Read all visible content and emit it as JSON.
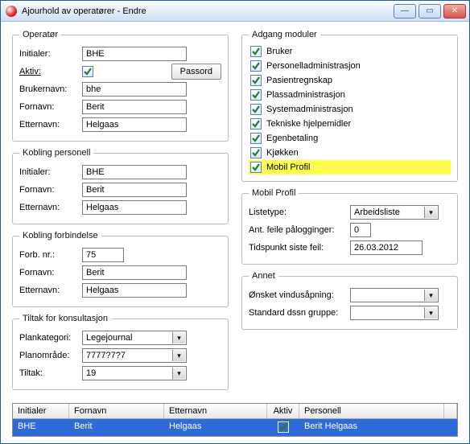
{
  "window": {
    "title": "Ajourhold av operatører - Endre"
  },
  "operator": {
    "legend": "Operatør",
    "initials_label": "Initialer:",
    "initials": "BHE",
    "active_label": "Aktiv:",
    "passord_btn": "Passord",
    "username_label": "Brukernavn:",
    "username": "bhe",
    "firstname_label": "Fornavn:",
    "firstname": "Berit",
    "lastname_label": "Etternavn:",
    "lastname": "Helgaas"
  },
  "kpersonell": {
    "legend": "Kobling personell",
    "initials_label": "Initialer:",
    "initials": "BHE",
    "firstname_label": "Fornavn:",
    "firstname": "Berit",
    "lastname_label": "Etternavn:",
    "lastname": "Helgaas"
  },
  "kforbindelse": {
    "legend": "Kobling forbindelse",
    "forbnr_label": "Forb. nr.:",
    "forbnr": "75",
    "firstname_label": "Fornavn:",
    "firstname": "Berit",
    "lastname_label": "Etternavn:",
    "lastname": "Helgaas"
  },
  "tiltak": {
    "legend": "Tiltak for konsultasjon",
    "plankat_label": "Plankategori:",
    "plankat": "Legejournal",
    "planomr_label": "Planområde:",
    "planomr": "7777?7?7",
    "tiltak_label": "Tiltak:",
    "tiltakv": "19"
  },
  "adgang": {
    "legend": "Adgang moduler",
    "items": [
      {
        "label": "Bruker",
        "checked": true,
        "hl": false
      },
      {
        "label": "Personelladministrasjon",
        "checked": true,
        "hl": false
      },
      {
        "label": "Pasientregnskap",
        "checked": true,
        "hl": false
      },
      {
        "label": "Plassadministrasjon",
        "checked": true,
        "hl": false
      },
      {
        "label": "Systemadministrasjon",
        "checked": true,
        "hl": false
      },
      {
        "label": "Tekniske hjelpemidler",
        "checked": true,
        "hl": false
      },
      {
        "label": "Egenbetaling",
        "checked": true,
        "hl": false
      },
      {
        "label": "Kjøkken",
        "checked": true,
        "hl": false
      },
      {
        "label": "Mobil Profil",
        "checked": true,
        "hl": true
      }
    ]
  },
  "mobil": {
    "legend": "Mobil Profil",
    "listetype_label": "Listetype:",
    "listetype": "Arbeidsliste",
    "antfeil_label": "Ant. feile pålogginger:",
    "antfeil": "0",
    "tidsfeil_label": "Tidspunkt siste feil:",
    "tidsfeil": "26.03.2012"
  },
  "annet": {
    "legend": "Annet",
    "vindu_label": "Ønsket vindusåpning:",
    "dssn_label": "Standard dssn gruppe:"
  },
  "table": {
    "headers": {
      "ini": "Initialer",
      "for": "Fornavn",
      "ett": "Etternavn",
      "akt": "Aktiv",
      "per": "Personell"
    },
    "row": {
      "ini": "BHE",
      "for": "Berit",
      "ett": "Helgaas",
      "per": "Berit Helgaas"
    }
  }
}
